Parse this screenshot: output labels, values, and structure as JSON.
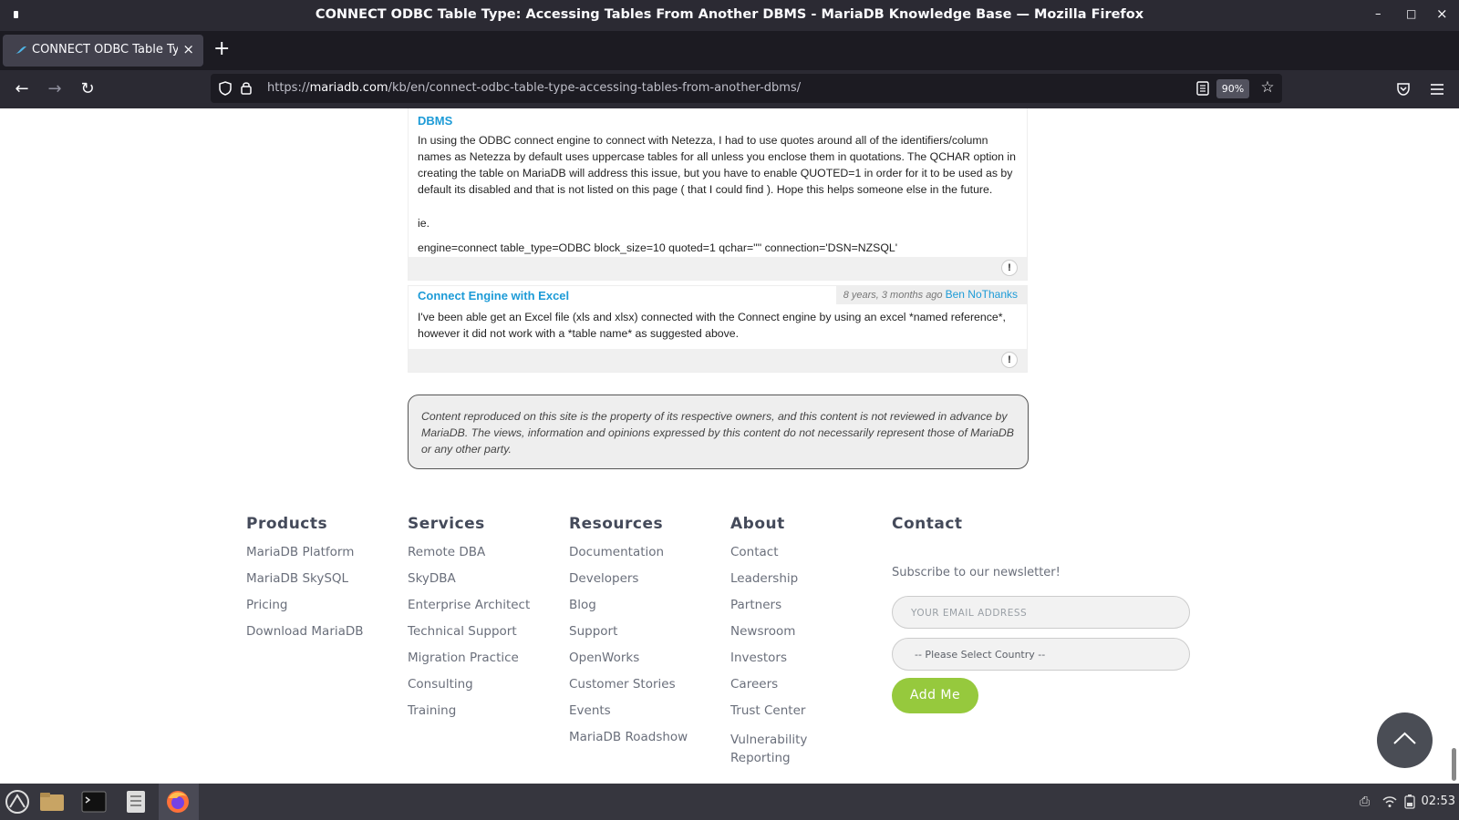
{
  "window": {
    "title": "CONNECT ODBC Table Type: Accessing Tables From Another DBMS - MariaDB Knowledge Base — Mozilla Firefox",
    "minimize": "–",
    "maximize": "□",
    "close": "×"
  },
  "tab": {
    "label": "CONNECT ODBC Table Type",
    "close": "×",
    "new_tab": "+"
  },
  "nav": {
    "url_prefix": "https://",
    "url_host": "mariadb.com",
    "url_path": "/kb/en/connect-odbc-table-type-accessing-tables-from-another-dbms/",
    "zoom": "90%"
  },
  "comments": [
    {
      "title": "DBMS",
      "paragraphs": [
        "In using the ODBC connect engine to connect with Netezza, I had to use quotes around all of the identifiers/column names as Netezza by default uses uppercase tables for all unless you enclose them in quotations. The QCHAR option in creating the table on MariaDB will address this issue, but you have to enable QUOTED=1 in order for it to be used as by default its disabled and that is not listed on this page ( that I could find ). Hope this helps someone else in the future.",
        "ie.",
        "engine=connect table_type=ODBC block_size=10 quoted=1 qchar='\"' connection='DSN=NZSQL'"
      ]
    },
    {
      "title": "Connect Engine with Excel",
      "meta_time": "8 years, 3 months ago",
      "meta_author": "Ben NoThanks",
      "paragraphs": [
        "I've been able get an Excel file (xls and xlsx) connected with the Connect engine by using an excel *named reference*, however it did not work with a *table name* as suggested above."
      ]
    }
  ],
  "disclaimer": "Content reproduced on this site is the property of its respective owners, and this content is not reviewed in advance by MariaDB. The views, information and opinions expressed by this content do not necessarily represent those of MariaDB or any other party.",
  "footer": {
    "products": {
      "heading": "Products",
      "links": [
        "MariaDB Platform",
        "MariaDB SkySQL",
        "Pricing",
        "Download MariaDB"
      ]
    },
    "services": {
      "heading": "Services",
      "links": [
        "Remote DBA",
        "SkyDBA",
        "Enterprise Architect",
        "Technical Support",
        "Migration Practice",
        "Consulting",
        "Training"
      ]
    },
    "resources": {
      "heading": "Resources",
      "links": [
        "Documentation",
        "Developers",
        "Blog",
        "Support",
        "OpenWorks",
        "Customer Stories",
        "Events",
        "MariaDB Roadshow"
      ]
    },
    "about": {
      "heading": "About",
      "links": [
        "Contact",
        "Leadership",
        "Partners",
        "Newsroom",
        "Investors",
        "Careers",
        "Trust Center",
        "Vulnerability Reporting"
      ]
    },
    "contact": {
      "heading": "Contact",
      "newsletter_label": "Subscribe to our newsletter!",
      "email_placeholder": "YOUR EMAIL ADDRESS",
      "country_select": "-- Please Select Country --",
      "submit_label": "Add Me"
    }
  },
  "taskbar": {
    "clock": "02:53"
  },
  "colors": {
    "link_blue": "#1d9bd7",
    "button_green": "#96c93d",
    "chrome_dark": "#2b2a33"
  }
}
